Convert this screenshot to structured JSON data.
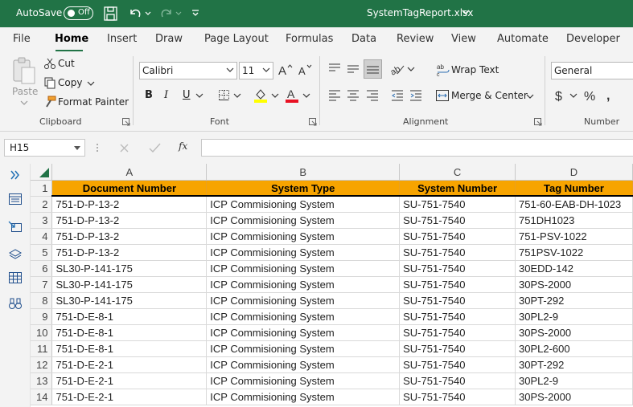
{
  "titlebar": {
    "autosave_label": "AutoSave",
    "autosave_state": "Off",
    "filename": "SystemTagReport.xlsx"
  },
  "tabs": [
    "File",
    "Home",
    "Insert",
    "Draw",
    "Page Layout",
    "Formulas",
    "Data",
    "Review",
    "View",
    "Automate",
    "Developer"
  ],
  "active_tab": "Home",
  "ribbon": {
    "clipboard": {
      "paste": "Paste",
      "cut": "Cut",
      "copy": "Copy",
      "format_painter": "Format Painter",
      "label": "Clipboard"
    },
    "font": {
      "name": "Calibri",
      "size": "11",
      "label": "Font",
      "bold": "B",
      "italic": "I",
      "underline": "U"
    },
    "alignment": {
      "wrap_text": "Wrap Text",
      "merge_center": "Merge & Center",
      "label": "Alignment"
    },
    "number": {
      "format": "General",
      "label": "Number"
    }
  },
  "formula_bar": {
    "name_box": "H15",
    "fx": "fx",
    "content": ""
  },
  "sheet": {
    "column_letters": [
      "A",
      "B",
      "C",
      "D"
    ],
    "header_row_number": "1",
    "headers": [
      "Document Number",
      "System Type",
      "System Number",
      "Tag Number"
    ],
    "rows": [
      {
        "n": "2",
        "cells": [
          "751-D-P-13-2",
          "ICP Commisioning System",
          "SU-751-7540",
          "751-60-EAB-DH-1023"
        ]
      },
      {
        "n": "3",
        "cells": [
          "751-D-P-13-2",
          "ICP Commisioning System",
          "SU-751-7540",
          "751DH1023"
        ]
      },
      {
        "n": "4",
        "cells": [
          "751-D-P-13-2",
          "ICP Commisioning System",
          "SU-751-7540",
          "751-PSV-1022"
        ]
      },
      {
        "n": "5",
        "cells": [
          "751-D-P-13-2",
          "ICP Commisioning System",
          "SU-751-7540",
          "751PSV-1022"
        ]
      },
      {
        "n": "6",
        "cells": [
          "SL30-P-141-175",
          "ICP Commisioning System",
          "SU-751-7540",
          "30EDD-142"
        ]
      },
      {
        "n": "7",
        "cells": [
          "SL30-P-141-175",
          "ICP Commisioning System",
          "SU-751-7540",
          "30PS-2000"
        ]
      },
      {
        "n": "8",
        "cells": [
          "SL30-P-141-175",
          "ICP Commisioning System",
          "SU-751-7540",
          "30PT-292"
        ]
      },
      {
        "n": "9",
        "cells": [
          "751-D-E-8-1",
          "ICP Commisioning System",
          "SU-751-7540",
          "30PL2-9"
        ]
      },
      {
        "n": "10",
        "cells": [
          "751-D-E-8-1",
          "ICP Commisioning System",
          "SU-751-7540",
          "30PS-2000"
        ]
      },
      {
        "n": "11",
        "cells": [
          "751-D-E-8-1",
          "ICP Commisioning System",
          "SU-751-7540",
          "30PL2-600"
        ]
      },
      {
        "n": "12",
        "cells": [
          "751-D-E-2-1",
          "ICP Commisioning System",
          "SU-751-7540",
          "30PT-292"
        ]
      },
      {
        "n": "13",
        "cells": [
          "751-D-E-2-1",
          "ICP Commisioning System",
          "SU-751-7540",
          "30PL2-9"
        ]
      },
      {
        "n": "14",
        "cells": [
          "751-D-E-2-1",
          "ICP Commisioning System",
          "SU-751-7540",
          "30PS-2000"
        ]
      }
    ]
  },
  "colors": {
    "brand": "#217346",
    "header_fill": "#f7a400"
  }
}
